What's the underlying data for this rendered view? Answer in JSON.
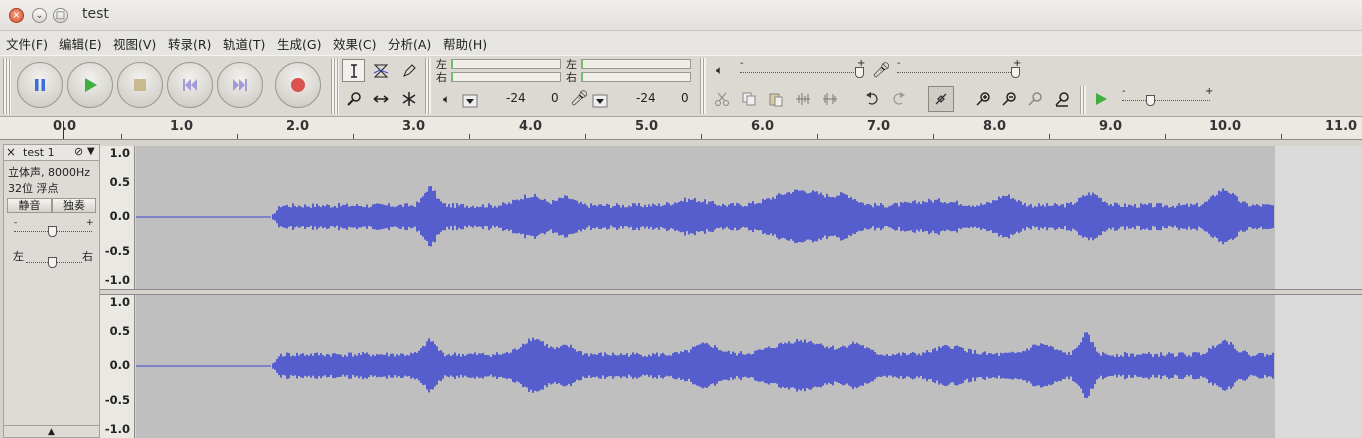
{
  "window": {
    "title": "test"
  },
  "menus": [
    "文件(F)",
    "编辑(E)",
    "视图(V)",
    "转录(R)",
    "轨道(T)",
    "生成(G)",
    "效果(C)",
    "分析(A)",
    "帮助(H)"
  ],
  "meter": {
    "play_left": "左",
    "play_right": "右",
    "rec_left": "左",
    "rec_right": "右",
    "play_db": "-24",
    "play_val": "0",
    "rec_db": "-24",
    "rec_val": "0"
  },
  "ruler": {
    "labels": [
      "0.0",
      "1.0",
      "2.0",
      "3.0",
      "4.0",
      "5.0",
      "6.0",
      "7.0",
      "8.0",
      "9.0",
      "10.0",
      "11.0"
    ]
  },
  "track": {
    "name": "test 1",
    "format": "立体声, 8000Hz",
    "bits": "32位 浮点",
    "mute": "静音",
    "solo": "独奏",
    "gain_minus": "-",
    "gain_plus": "+",
    "pan_left": "左",
    "pan_right": "右",
    "collapse": "▲",
    "close": "×",
    "menu": "▼"
  },
  "scale": {
    "labels": [
      "1.0",
      "0.5",
      "0.0",
      "-0.5",
      "-1.0"
    ]
  },
  "colors": {
    "wave": "#3c46d2",
    "wave_bg": "#bfbfbf",
    "record": "#d9534f",
    "play": "#3fae3f",
    "pause": "#3c6ed8"
  }
}
